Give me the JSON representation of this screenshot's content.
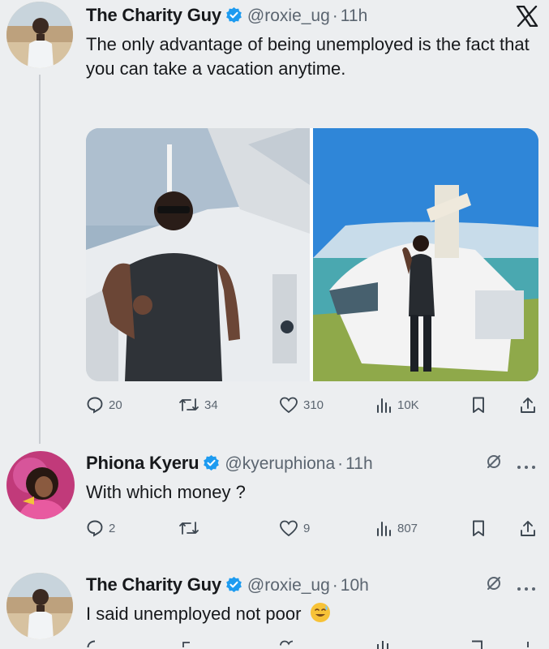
{
  "tweet": {
    "display_name": "The Charity Guy",
    "handle": "@roxie_ug",
    "separator": "·",
    "time": "11h",
    "text": "The only advantage of being unemployed is the fact that you can take a vacation anytime.",
    "actions": {
      "replies": "20",
      "retweets": "34",
      "likes": "310",
      "views": "10K"
    }
  },
  "reply1": {
    "display_name": "Phiona Kyeru",
    "handle": "@kyeruphiona",
    "separator": "·",
    "time": "11h",
    "text": "With which money ?",
    "actions": {
      "replies": "2",
      "retweets": "",
      "likes": "9",
      "views": "807"
    }
  },
  "reply2": {
    "display_name": "The Charity Guy",
    "handle": "@roxie_ug",
    "separator": "·",
    "time": "10h",
    "text": "I said unemployed not poor",
    "emoji": "sweat-smile-emoji"
  },
  "colors": {
    "verified": "#1d9bf0",
    "text": "#16181b",
    "muted": "#5b6570",
    "background": "#eceef0"
  },
  "icons": [
    "close-x-logo",
    "reply-icon",
    "retweet-icon",
    "like-icon",
    "views-icon",
    "bookmark-icon",
    "share-icon",
    "grok-icon",
    "more-icon"
  ]
}
